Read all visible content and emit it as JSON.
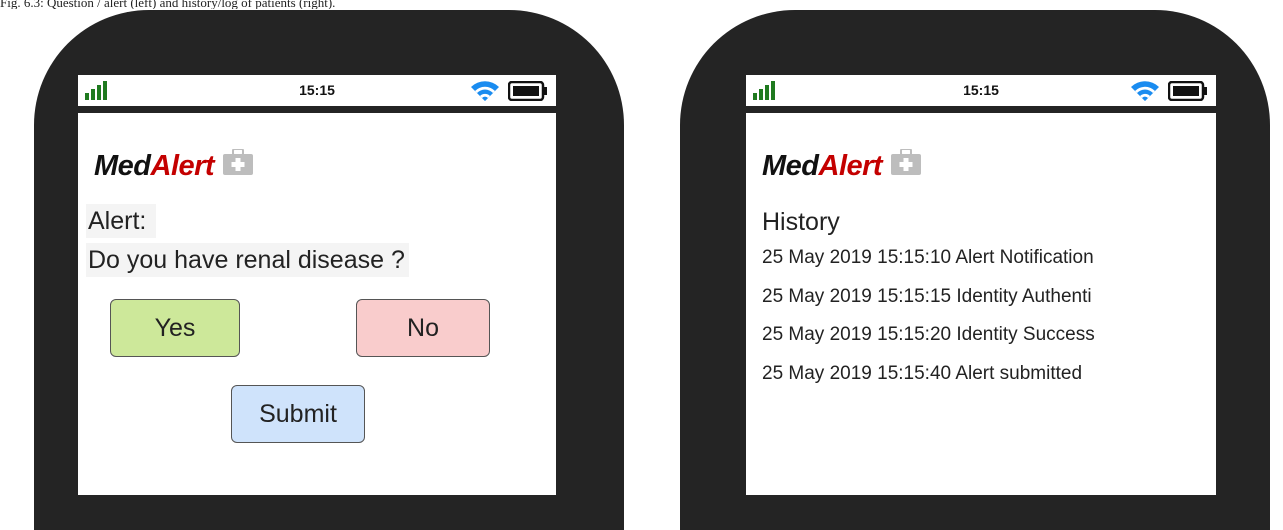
{
  "caption": "Fig. 6.3: Question / alert (left) and history/log of patients (right).",
  "colors": {
    "phone_frame": "#242424",
    "brand_alert": "#c40000",
    "yes_button": "#cde89a",
    "no_button": "#f9cccc",
    "submit_button": "#cfe3fb",
    "wifi": "#1a8cf0",
    "kit_icon": "#bdbdbd"
  },
  "left_phone": {
    "status": {
      "time": "15:15",
      "icons": [
        "signal-icon",
        "wifi-icon",
        "battery-icon"
      ]
    },
    "brand": {
      "part1": "Med",
      "part2": "Alert",
      "icon": "first-aid-kit-icon"
    },
    "alert_label": "Alert:",
    "question": "Do you have renal disease ?",
    "yes_label": "Yes",
    "no_label": "No",
    "submit_label": "Submit"
  },
  "right_phone": {
    "status": {
      "time": "15:15",
      "icons": [
        "signal-icon",
        "wifi-icon",
        "battery-icon"
      ]
    },
    "brand": {
      "part1": "Med",
      "part2": "Alert",
      "icon": "first-aid-kit-icon"
    },
    "history_title": "History",
    "entries": [
      "25 May 2019  15:15:10 Alert Notification",
      "25 May 2019  15:15:15 Identity Authenti",
      "25 May 2019  15:15:20 Identity Success",
      "25 May 2019  15:15:40 Alert submitted"
    ]
  }
}
